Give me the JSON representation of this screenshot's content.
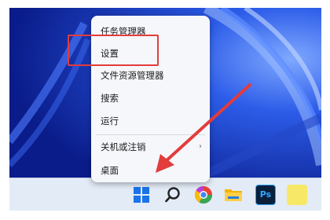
{
  "context_menu": {
    "items": [
      {
        "label": "任务管理器"
      },
      {
        "label": "设置"
      },
      {
        "label": "文件资源管理器"
      },
      {
        "label": "搜索"
      },
      {
        "label": "运行"
      },
      {
        "label": "关机或注销",
        "has_submenu": true
      },
      {
        "label": "桌面"
      }
    ],
    "submenu_arrow": "›"
  },
  "taskbar": {
    "icons": [
      "windows-start-icon",
      "search-icon",
      "chrome-browser-icon",
      "file-explorer-icon",
      "photoshop-icon",
      "sticky-notes-icon"
    ],
    "photoshop_label": "Ps"
  },
  "colors": {
    "highlight_box": "#e23c3c",
    "annotation_arrow": "#e23c3c",
    "wallpaper": "#1c3dbd",
    "taskbar": "#e3ebf6"
  }
}
